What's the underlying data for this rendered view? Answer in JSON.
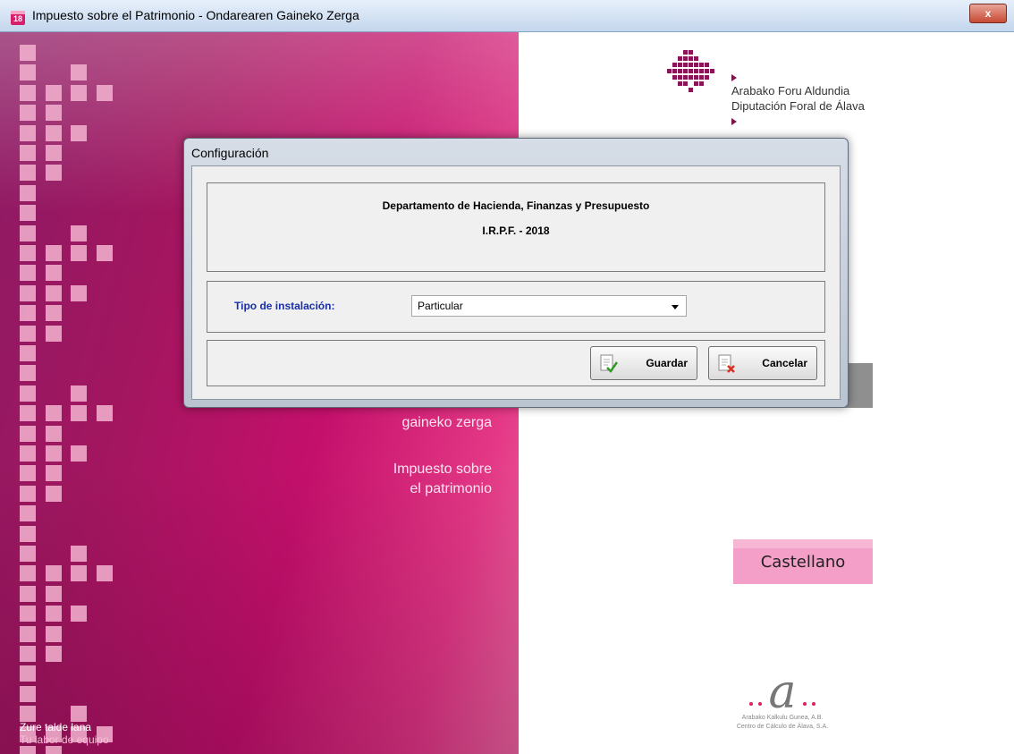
{
  "window": {
    "title": "Impuesto sobre el Patrimonio - Ondarearen Gaineko Zerga",
    "app_icon_text": "18",
    "close_glyph": "x"
  },
  "left_panel": {
    "brand_eu": "gaineko zerga",
    "brand_es_line1": "Impuesto sobre",
    "brand_es_line2": "el patrimonio",
    "footer_eu": "Zure talde lana",
    "footer_es": "Tu labor de equipo"
  },
  "logo": {
    "line1": "Arabako Foru Aldundia",
    "line2": "Diputación Foral de Álava"
  },
  "language_button": "Castellano",
  "ccaa": {
    "letter": "a",
    "line1": "Arabako Kalkulu Gunea, A.B.",
    "line2": "Centro de Cálculo de Álava, S.A."
  },
  "dialog": {
    "title": "Configuración",
    "department": "Departamento de Hacienda, Finanzas y Presupuesto",
    "year_label": "I.R.P.F. - 2018",
    "tipo_label": "Tipo de instalación:",
    "tipo_value": "Particular",
    "save_label": "Guardar",
    "cancel_label": "Cancelar"
  },
  "colors": {
    "brand_magenta": "#c4106b",
    "label_blue": "#1a2fa8",
    "language_pink": "#f49fc7"
  }
}
